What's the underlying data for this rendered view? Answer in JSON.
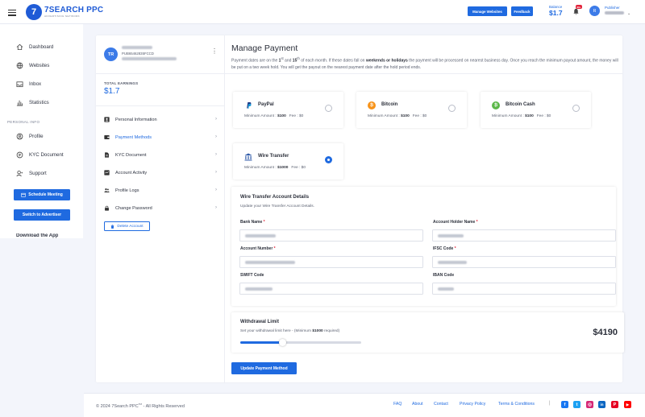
{
  "header": {
    "logo_mark": "7",
    "logo_title": "7SEARCH PPC",
    "logo_tagline": "ADVERTISING NETWORK",
    "manage_websites": "Manage Websites",
    "feedback": "Feedback",
    "balance_label": "Balance",
    "balance_value": "$1.7",
    "notif_count": "99+",
    "avatar_initial": "R",
    "role": "Publisher"
  },
  "sidebar": {
    "items": [
      {
        "label": "Dashboard",
        "icon": "home-icon"
      },
      {
        "label": "Websites",
        "icon": "globe-icon"
      },
      {
        "label": "Inbox",
        "icon": "inbox-icon"
      },
      {
        "label": "Statistics",
        "icon": "bar-chart-icon"
      }
    ],
    "section_label": "PERSONAL INFO",
    "personal_items": [
      {
        "label": "Profile",
        "icon": "user-icon"
      },
      {
        "label": "KYC Document",
        "icon": "document-icon"
      },
      {
        "label": "Support",
        "icon": "support-icon"
      }
    ],
    "schedule_meeting": "Schedule Meeting",
    "switch_advertiser": "Switch to Advertiser",
    "download_app": "Download the App"
  },
  "profile": {
    "initials": "TR",
    "user_id": "PUB65462835FCCD",
    "total_earnings_label": "TOTAL EARNINGS",
    "total_earnings_value": "$1.7",
    "menu": [
      {
        "label": "Personal Information",
        "icon": "user-card-icon"
      },
      {
        "label": "Payment Methods",
        "icon": "wallet-icon"
      },
      {
        "label": "KYC Document",
        "icon": "file-icon"
      },
      {
        "label": "Account Activity",
        "icon": "activity-icon"
      },
      {
        "label": "Profile Logs",
        "icon": "users-icon"
      },
      {
        "label": "Change Password",
        "icon": "lock-icon"
      }
    ],
    "delete_account": "Delete Account"
  },
  "manage_payment": {
    "title": "Manage Payment",
    "desc_1": "Payment dates are on the ",
    "desc_1st": "1",
    "desc_st": "st",
    "desc_and": " and ",
    "desc_15": "15",
    "desc_th": "th",
    "desc_2": " of each month. If these dates fall on ",
    "desc_bold": "weekends or holidays",
    "desc_3": " the payment will be processed on nearest business day. Once you reach the minimum payout amount, the money will be put on a two week hold. You will get the payout on the nearest payment date after the hold period ends."
  },
  "methods": [
    {
      "name": "PayPal",
      "min_label": "Minimum Amount : ",
      "min": "$100",
      "fee": "Fee : $0",
      "color": "#1f3c88",
      "selected": false
    },
    {
      "name": "Bitcoin",
      "min_label": "Minimum Amount : ",
      "min": "$100",
      "fee": "Fee : $0",
      "color": "#f7931a",
      "selected": false
    },
    {
      "name": "Bitcoin Cash",
      "min_label": "Minimum Amount : ",
      "min": "$100",
      "fee": "Fee : $0",
      "color": "#5cb849",
      "selected": false
    },
    {
      "name": "Wire Transfer",
      "min_label": "Minimum Amount : ",
      "min": "$1000",
      "fee": "Fee : $0",
      "color": "#2f5aa8",
      "selected": true
    }
  ],
  "wire_form": {
    "title": "Wire Transfer Account Details",
    "subtitle": "Update your Wire Transfer Account Details.",
    "bank_name": "Bank Name",
    "holder_name": "Account Holder Name",
    "account_number": "Account Number",
    "ifsc": "IFSC Code",
    "swift": "SWIFT Code",
    "iban": "IBAN Code",
    "required_mark": "*"
  },
  "withdrawal": {
    "title": "Withdrawal Limit",
    "sub_prefix": "Set your withdrawal limit here - (Minimum ",
    "sub_min": "$1000",
    "sub_suffix": " required)",
    "amount": "$4190",
    "slider_level": 0.35
  },
  "update_button": "Update Payment Method",
  "footer": {
    "copyright": "© 2024 7Search PPC",
    "tm": "TM",
    "rights": " - All Rights Reserved",
    "links": [
      "FAQ",
      "About",
      "Contact",
      "Privacy Policy",
      "Terms & Conditions"
    ],
    "social": [
      {
        "icon": "facebook-icon",
        "glyph": "f",
        "color": "#1877f2"
      },
      {
        "icon": "twitter-icon",
        "glyph": "t",
        "color": "#1da1f2"
      },
      {
        "icon": "instagram-icon",
        "glyph": "◎",
        "color": "#d62976"
      },
      {
        "icon": "linkedin-icon",
        "glyph": "in",
        "color": "#0a66c2"
      },
      {
        "icon": "pinterest-icon",
        "glyph": "P",
        "color": "#e60023"
      },
      {
        "icon": "youtube-icon",
        "glyph": "▶",
        "color": "#ff0000"
      }
    ]
  }
}
